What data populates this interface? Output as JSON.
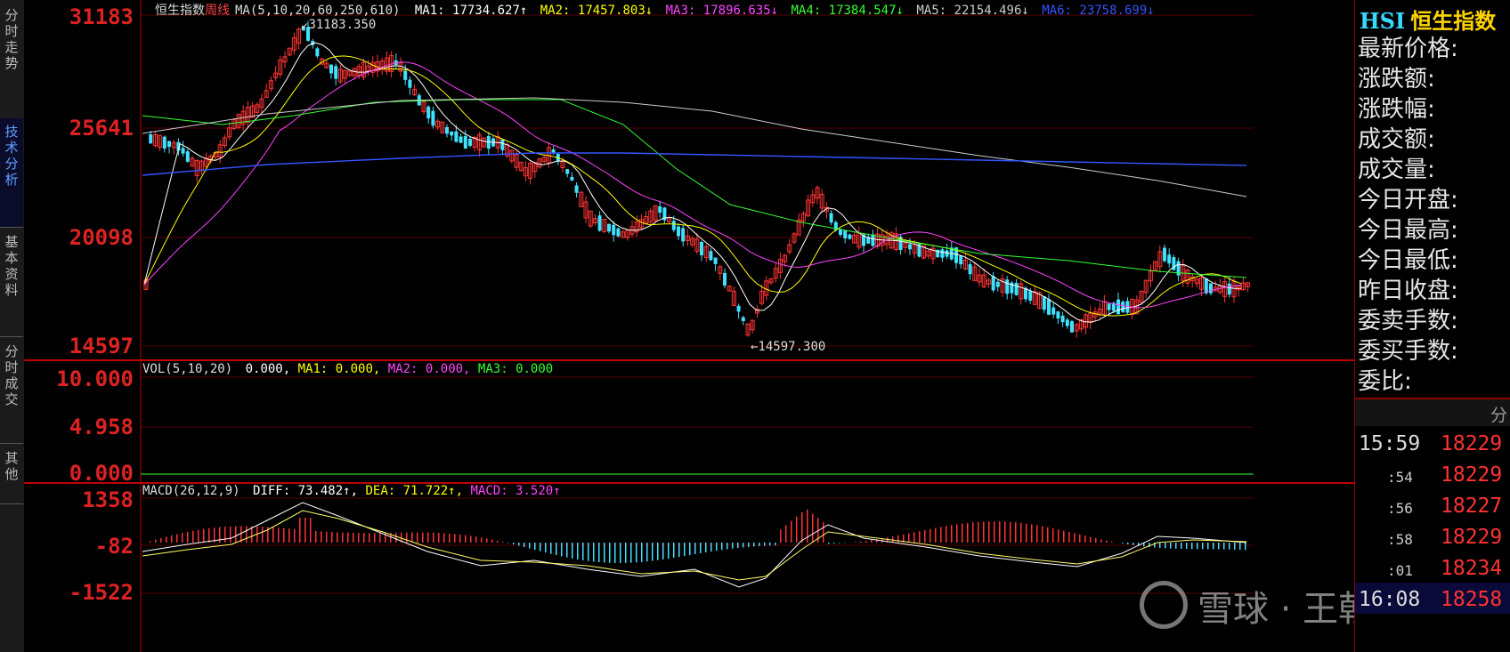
{
  "side_tabs": [
    "分时走势",
    "技术分析",
    "基本资料",
    "分时成交",
    "其他"
  ],
  "active_tab": 1,
  "main_chart": {
    "legend_prefix": "恒生指数",
    "period": "周线",
    "ma_spec": "MA(5,10,20,60,250,610)",
    "ma_values": [
      {
        "label": "MA1: 17734.627↑",
        "color": "#ffffff"
      },
      {
        "label": "MA2: 17457.803↓",
        "color": "#ffff00"
      },
      {
        "label": "MA3: 17896.635↓",
        "color": "#ff44ff"
      },
      {
        "label": "MA4: 17384.547↓",
        "color": "#33ff33"
      },
      {
        "label": "MA5: 22154.496↓",
        "color": "#cccccc"
      },
      {
        "label": "MA6: 23758.699↓",
        "color": "#3355ff"
      }
    ],
    "y_ticks": [
      "31183",
      "25641",
      "20098",
      "14597"
    ],
    "high_label": "31183.350",
    "low_label": "14597.300"
  },
  "volume_panel": {
    "legend": "VOL(5,10,20)",
    "values": [
      {
        "label": "0.000,",
        "color": "#ffffff"
      },
      {
        "label": "MA1: 0.000,",
        "color": "#ffff00"
      },
      {
        "label": "MA2: 0.000,",
        "color": "#ff44ff"
      },
      {
        "label": "MA3: 0.000",
        "color": "#33ff33"
      }
    ],
    "y_ticks": [
      "10.000",
      "4.958",
      "0.000"
    ]
  },
  "macd_panel": {
    "legend": "MACD(26,12,9)",
    "values": [
      {
        "label": "DIFF: 73.482↑,",
        "color": "#ffffff"
      },
      {
        "label": "DEA: 71.722↑,",
        "color": "#ffff00"
      },
      {
        "label": "MACD: 3.520↑",
        "color": "#ff44ff"
      }
    ],
    "y_ticks": [
      "1358",
      "-82",
      "-1522"
    ]
  },
  "info_panel": {
    "code": "HSI",
    "name": "恒生指数",
    "fields": [
      "最新价格:",
      "涨跌额:",
      "涨跌幅:",
      "成交额:",
      "成交量:",
      "今日开盘:",
      "今日最高:",
      "今日最低:",
      "昨日收盘:",
      "委卖手数:",
      "委买手数:",
      "委比:"
    ],
    "ticks_header": "分",
    "ticks": [
      {
        "time": "15:59",
        "price": "18229"
      },
      {
        "time": ":54",
        "price": "18229"
      },
      {
        "time": ":56",
        "price": "18227"
      },
      {
        "time": ":58",
        "price": "18229"
      },
      {
        "time": ":01",
        "price": "18234"
      },
      {
        "time": "16:08",
        "price": "18258"
      }
    ]
  },
  "watermark": "雪球 · 王朝雄",
  "colors": {
    "up": "#ff3333",
    "down": "#40e0ff",
    "axis": "#ff3333",
    "grid": "#600000"
  }
}
